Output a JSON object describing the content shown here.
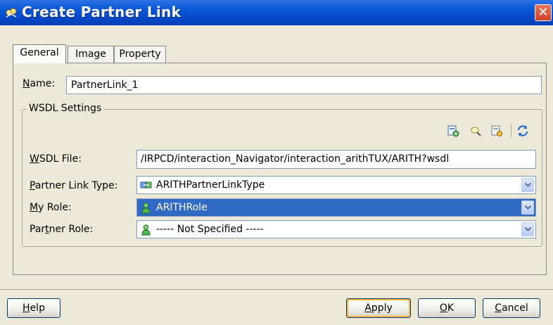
{
  "window": {
    "title": "Create Partner Link",
    "close_label": "✕"
  },
  "tabs": [
    {
      "label": "General",
      "active": true
    },
    {
      "label": "Image",
      "active": false
    },
    {
      "label": "Property",
      "active": false
    }
  ],
  "form": {
    "name_label_mnemonic": "N",
    "name_label_rest": "ame:",
    "name_value": "PartnerLink_1"
  },
  "wsdl": {
    "legend": "WSDL Settings",
    "toolbar_icons": [
      "service-explorer-icon",
      "browse-wsdl-icon",
      "define-adapter-icon",
      "refresh-icon"
    ],
    "file_label_mnemonic": "W",
    "file_label_rest": "SDL File:",
    "file_value": "/IRPCD/interaction_Navigator/interaction_arithTUX/ARITH?wsdl",
    "link_type_label_pre": "",
    "link_type_label_mnemonic": "P",
    "link_type_label_rest": "artner Link Type:",
    "link_type_value": "ARITHPartnerLinkType",
    "my_role_label_mnemonic": "M",
    "my_role_label_rest": "y Role:",
    "my_role_value": "ARITHRole",
    "partner_role_label_pre": "Par",
    "partner_role_label_mnemonic": "t",
    "partner_role_label_rest": "ner Role:",
    "partner_role_value": "----- Not Specified -----"
  },
  "buttons": {
    "help_mnemonic": "H",
    "help_rest": "elp",
    "apply_mnemonic": "A",
    "apply_rest": "pply",
    "ok_mnemonic": "O",
    "ok_rest": "K",
    "cancel_mnemonic": "C",
    "cancel_rest": "ancel"
  },
  "colors": {
    "titlebar": "#0a59d8",
    "selection": "#316ac5",
    "dialog_bg": "#ece9d8"
  }
}
